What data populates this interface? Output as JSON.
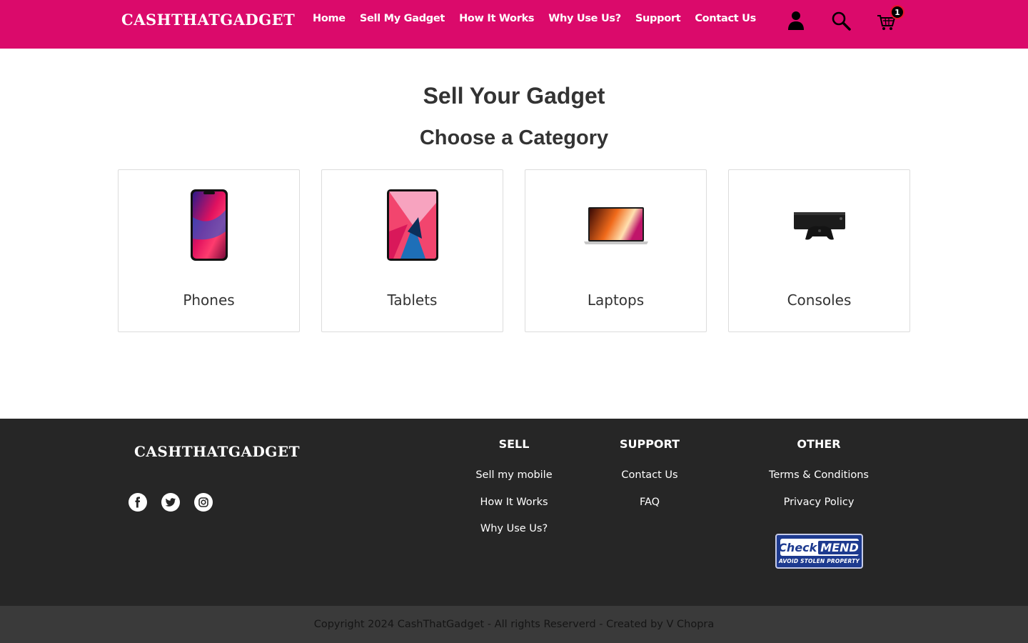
{
  "header": {
    "brand": "CASHTHATGADGET",
    "nav": [
      "Home",
      "Sell My Gadget",
      "How It Works",
      "Why Use Us?",
      "Support",
      "Contact Us"
    ],
    "icons": [
      "user-icon",
      "search-icon",
      "cart-icon"
    ],
    "cart_count": "1",
    "accent_color": "#db0a6b"
  },
  "main": {
    "title": "Sell Your Gadget",
    "subtitle": "Choose a Category",
    "categories": [
      {
        "label": "Phones",
        "icon": "phone-image"
      },
      {
        "label": "Tablets",
        "icon": "tablet-image"
      },
      {
        "label": "Laptops",
        "icon": "laptop-image"
      },
      {
        "label": "Consoles",
        "icon": "console-image"
      }
    ]
  },
  "footer": {
    "brand": "CASHTHATGADGET",
    "social": [
      "facebook-icon",
      "twitter-icon",
      "instagram-icon"
    ],
    "columns": [
      {
        "heading": "SELL",
        "links": [
          "Sell my mobile",
          "How It Works",
          "Why Use Us?"
        ]
      },
      {
        "heading": "SUPPORT",
        "links": [
          "Contact Us",
          "FAQ"
        ]
      },
      {
        "heading": "OTHER",
        "links": [
          "Terms & Conditions",
          "Privacy Policy"
        ]
      }
    ],
    "checkmend": {
      "check": "Check",
      "mend": "MEND",
      "tagline": "AVOID STOLEN PROPERTY"
    },
    "copyright": "Copyright 2024 CashThatGadget - All rights Reserverd - Created by V Chopra",
    "background": "#262626"
  }
}
